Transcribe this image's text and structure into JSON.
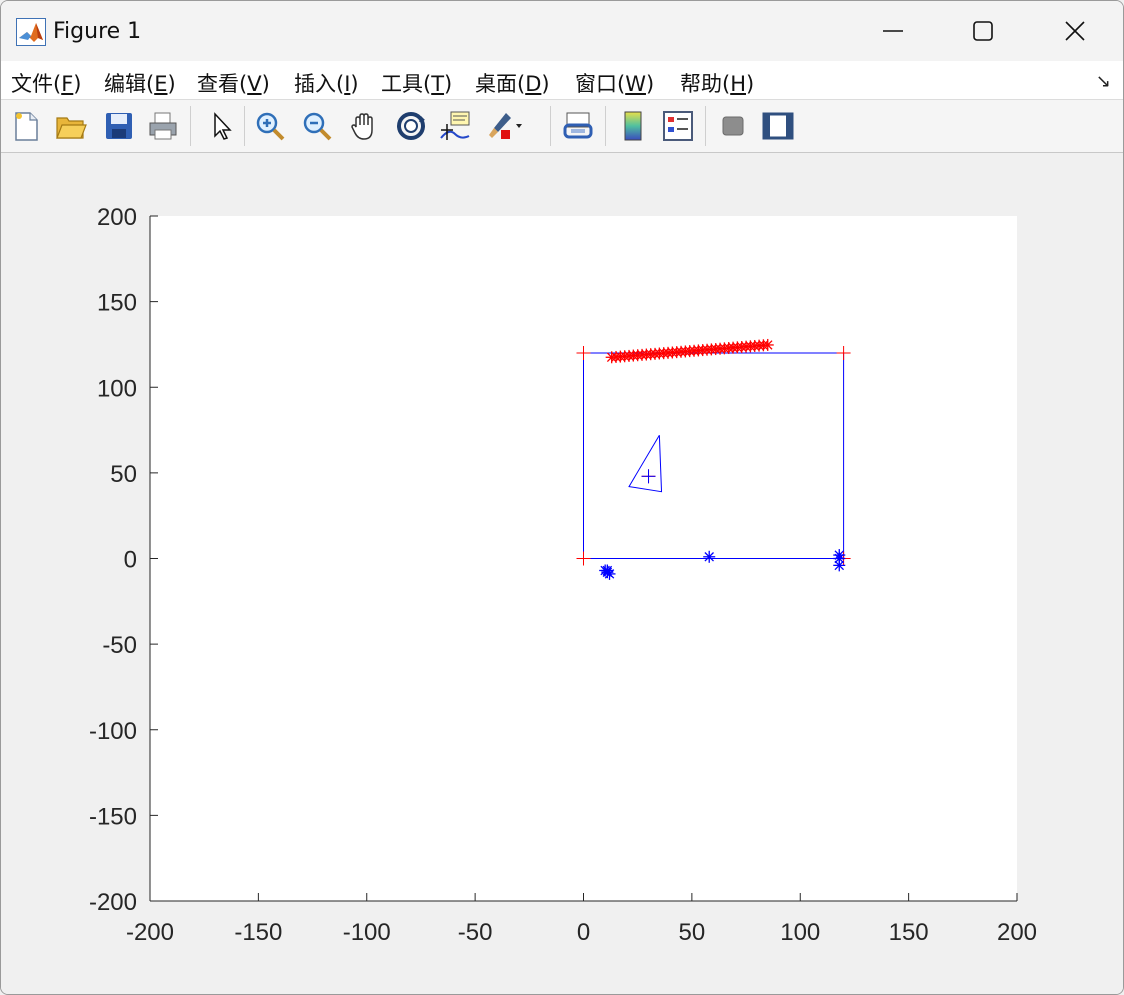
{
  "window": {
    "title": "Figure 1",
    "app_icon": "matlab-logo-icon",
    "controls": [
      "minimize-icon",
      "maximize-icon",
      "close-icon"
    ]
  },
  "menubar": {
    "items": [
      {
        "label": "文件(",
        "key": "F",
        "tail": ")"
      },
      {
        "label": "编辑(",
        "key": "E",
        "tail": ")"
      },
      {
        "label": "查看(",
        "key": "V",
        "tail": ")"
      },
      {
        "label": "插入(",
        "key": "I",
        "tail": ")"
      },
      {
        "label": "工具(",
        "key": "T",
        "tail": ")"
      },
      {
        "label": "桌面(",
        "key": "D",
        "tail": ")"
      },
      {
        "label": "窗口(",
        "key": "W",
        "tail": ")"
      },
      {
        "label": "帮助(",
        "key": "H",
        "tail": ")"
      }
    ],
    "dock_icon": "dock-arrow-icon"
  },
  "toolbar": {
    "buttons": [
      "new-figure-icon",
      "open-file-icon",
      "save-icon",
      "print-icon",
      "pointer-icon",
      "zoom-in-icon",
      "zoom-out-icon",
      "pan-hand-icon",
      "rotate-3d-icon",
      "data-cursor-icon",
      "brush-icon",
      "link-plot-icon",
      "colorbar-icon",
      "legend-icon",
      "hide-plot-tools-icon",
      "show-plot-tools-icon"
    ]
  },
  "chart_data": {
    "type": "scatter",
    "title": "",
    "xlabel": "",
    "ylabel": "",
    "xlim": [
      -200,
      200
    ],
    "ylim": [
      -200,
      200
    ],
    "xticks": [
      "-200",
      "-150",
      "-100",
      "-50",
      "0",
      "50",
      "100",
      "150",
      "200"
    ],
    "yticks": [
      "200",
      "150",
      "100",
      "50",
      "0",
      "-50",
      "-100",
      "-150",
      "-200"
    ],
    "grid": false,
    "series": [
      {
        "kind": "line",
        "color": "#0000ff",
        "x": [
          0,
          120,
          120,
          0,
          0
        ],
        "y": [
          0,
          0,
          120,
          120,
          0
        ]
      },
      {
        "kind": "line",
        "color": "#0000ff",
        "x": [
          35,
          21,
          36,
          35
        ],
        "y": [
          72,
          42,
          39,
          72
        ]
      },
      {
        "kind": "marker",
        "marker": "plus",
        "color": "#ff0000",
        "x": [
          0,
          120,
          120,
          0,
          30
        ],
        "y": [
          0,
          0,
          120,
          120,
          48
        ]
      },
      {
        "kind": "marker",
        "marker": "plus",
        "color": "#0000ff",
        "x": [
          30
        ],
        "y": [
          48
        ]
      },
      {
        "kind": "marker",
        "marker": "asterisk",
        "color": "#ff0000",
        "x": [
          13,
          15,
          17,
          19,
          21,
          23,
          25,
          27,
          29,
          31,
          33,
          35,
          37,
          39,
          41,
          43,
          45,
          47,
          49,
          51,
          53,
          55,
          57,
          59,
          61,
          63,
          65,
          67,
          69,
          71,
          73,
          75,
          77,
          79,
          81,
          83,
          85
        ],
        "y": [
          117.5,
          117.7,
          117.9,
          118.1,
          118.3,
          118.5,
          118.7,
          118.9,
          119.1,
          119.3,
          119.5,
          119.7,
          119.9,
          120.1,
          120.3,
          120.5,
          120.7,
          120.9,
          121.1,
          121.3,
          121.5,
          121.7,
          121.9,
          122.1,
          122.3,
          122.5,
          122.7,
          122.9,
          123.1,
          123.3,
          123.5,
          123.7,
          123.9,
          124.1,
          124.3,
          124.5,
          124.7
        ]
      },
      {
        "kind": "marker",
        "marker": "asterisk",
        "color": "#0000ff",
        "x": [
          10,
          11,
          12,
          11,
          58,
          118,
          118,
          118
        ],
        "y": [
          -7,
          -8,
          -9,
          -7,
          1,
          2,
          0,
          -4
        ]
      }
    ]
  }
}
